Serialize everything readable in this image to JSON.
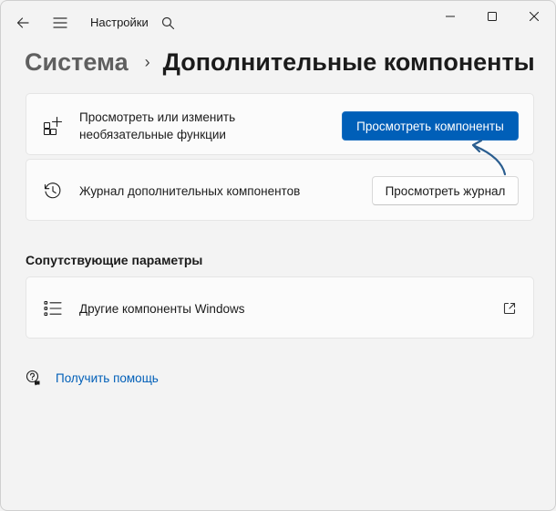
{
  "titlebar": {
    "back_icon": "back-arrow-icon",
    "menu_icon": "hamburger-icon",
    "title": "Настройки",
    "search_icon": "search-icon",
    "window_controls": [
      "minimize",
      "maximize",
      "close"
    ]
  },
  "breadcrumb": {
    "root": "Система",
    "separator": "›",
    "current": "Дополнительные компоненты"
  },
  "cards": {
    "optional_features": {
      "icon": "add-apps-icon",
      "label_line1": "Просмотреть или изменить",
      "label_line2": "необязательные функции",
      "button": "Просмотреть компоненты"
    },
    "history": {
      "icon": "history-icon",
      "label": "Журнал дополнительных компонентов",
      "button": "Просмотреть журнал"
    }
  },
  "related": {
    "heading": "Сопутствующие параметры",
    "items": [
      {
        "icon": "list-icon",
        "label": "Другие компоненты Windows",
        "action_icon": "open-external-icon"
      }
    ]
  },
  "help": {
    "icon": "help-icon",
    "label": "Получить помощь"
  },
  "colors": {
    "accent": "#005fb8",
    "annotation_arrow": "#2a5d8f",
    "background": "#f3f3f3",
    "card": "#fbfbfb"
  }
}
